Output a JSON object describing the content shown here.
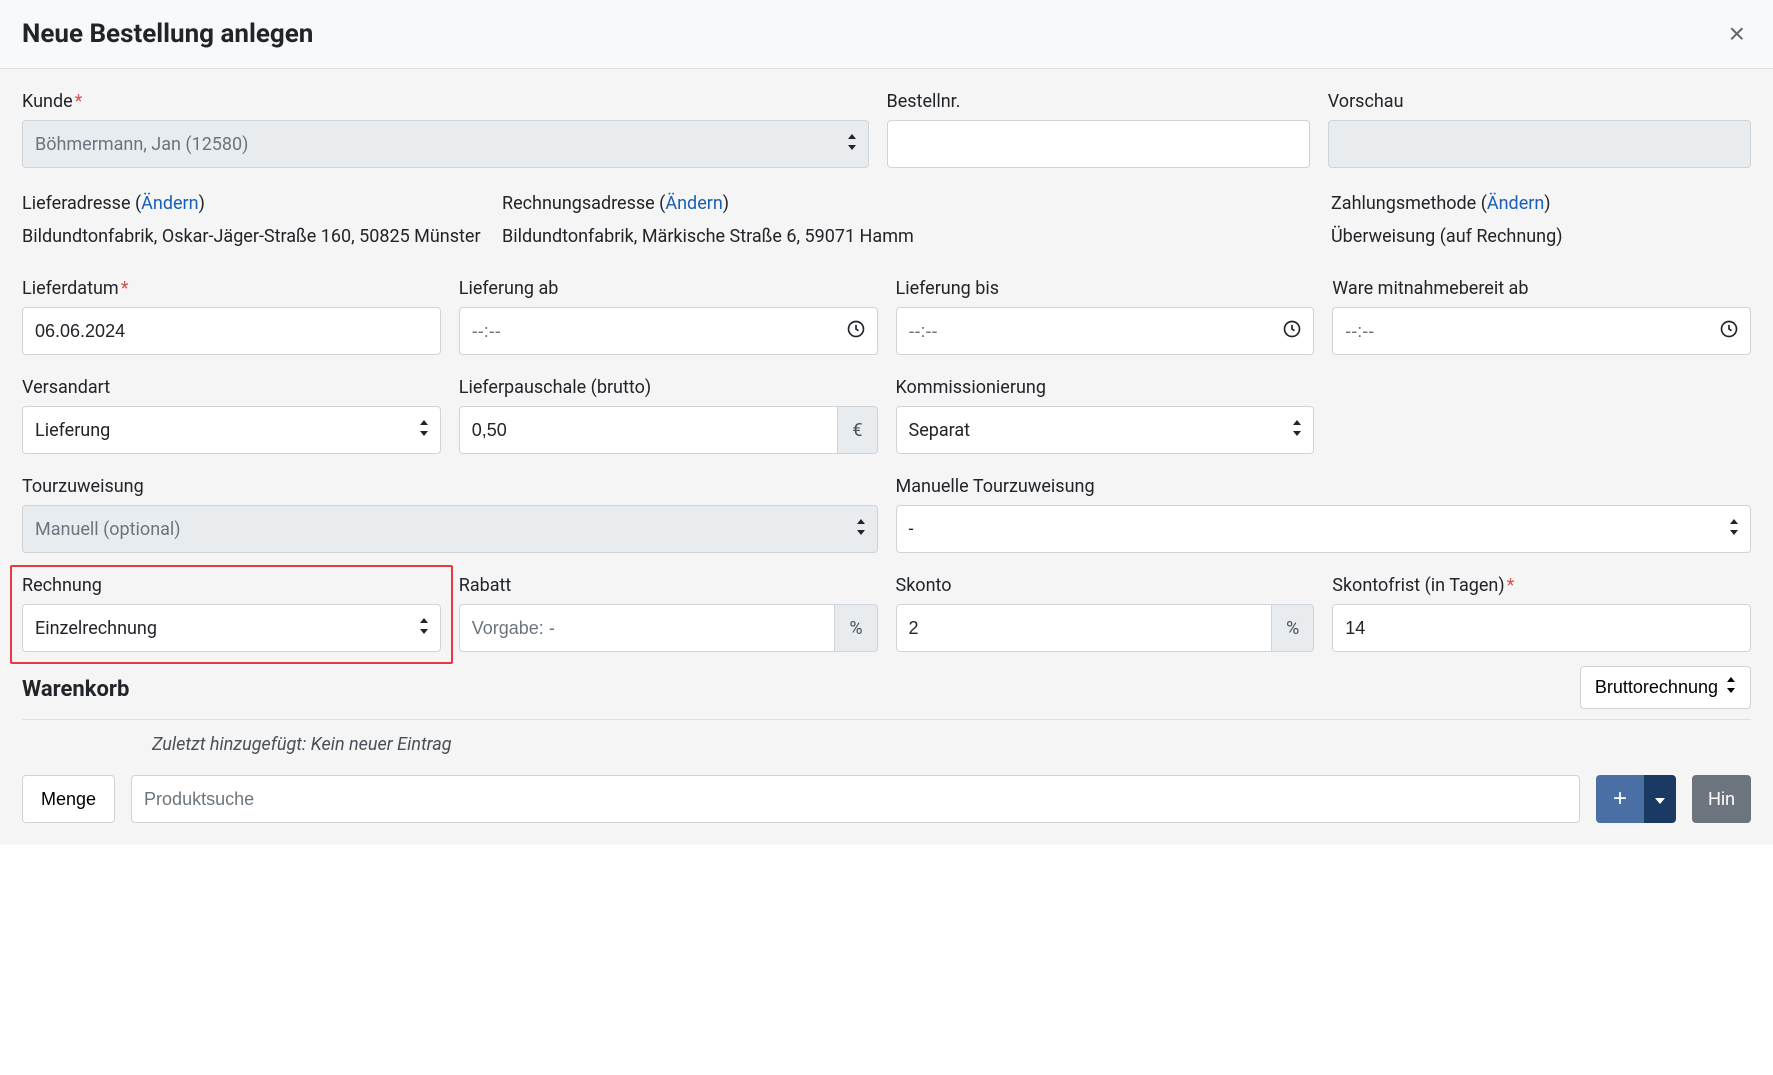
{
  "header": {
    "title": "Neue Bestellung anlegen"
  },
  "labels": {
    "customer": "Kunde",
    "orderno": "Bestellnr.",
    "preview": "Vorschau",
    "shipaddr": "Lieferadresse",
    "billaddr": "Rechnungsadresse",
    "paymethod": "Zahlungsmethode",
    "change": "Ändern",
    "deliverydate": "Lieferdatum",
    "deliveryfrom": "Lieferung ab",
    "deliveryuntil": "Lieferung bis",
    "readyfrom": "Ware mitnahmebereit ab",
    "shipmethod": "Versandart",
    "flatrate": "Lieferpauschale (brutto)",
    "picking": "Kommissionierung",
    "tourassign": "Tourzuweisung",
    "manualtour": "Manuelle Tourzuweisung",
    "invoice": "Rechnung",
    "discount": "Rabatt",
    "skonto": "Skonto",
    "skontodeadline": "Skontofrist (in Tagen)",
    "cart": "Warenkorb",
    "pricemode": "Bruttorechnung",
    "lastadded_prefix": "Zuletzt hinzugefügt: ",
    "lastadded_value": "Kein neuer Eintrag",
    "qty": "Menge",
    "search_ph": "Produktsuche",
    "hint": "Hin",
    "time_ph": "--:--",
    "euro": "€",
    "percent": "%"
  },
  "values": {
    "customer": "Böhmermann, Jan (12580)",
    "shipaddr": "Bildundtonfabrik, Oskar-Jäger-Straße 160, 50825 Münster",
    "billaddr": "Bildundtonfabrik, Märkische Straße 6, 59071 Hamm",
    "paymethod": "Überweisung (auf Rechnung)",
    "deliverydate": "06.06.2024",
    "shipmethod": "Lieferung",
    "flatrate": "0,50",
    "picking": "Separat",
    "tourassign_ph": "Manuell (optional)",
    "manualtour": "-",
    "invoice": "Einzelrechnung",
    "discount_ph": "Vorgabe: -",
    "skonto": "2",
    "skontodeadline": "14"
  }
}
